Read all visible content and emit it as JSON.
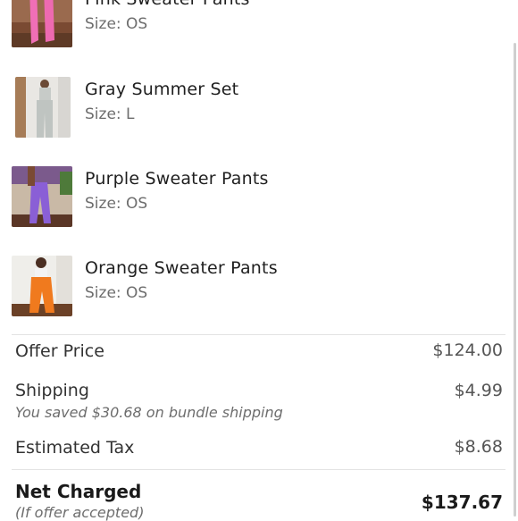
{
  "items": [
    {
      "name": "Pink Sweater Pants",
      "size": "Size: OS",
      "image": "pink-sweater-pants-photo"
    },
    {
      "name": "Gray Summer Set",
      "size": "Size: L",
      "image": "gray-summer-set-photo"
    },
    {
      "name": "Purple Sweater Pants",
      "size": "Size: OS",
      "image": "purple-sweater-pants-photo"
    },
    {
      "name": "Orange Sweater Pants",
      "size": "Size: OS",
      "image": "orange-sweater-pants-photo"
    }
  ],
  "summary": {
    "offer_price": {
      "label": "Offer Price",
      "value": "$124.00"
    },
    "shipping": {
      "label": "Shipping",
      "value": "$4.99",
      "note": "You saved $30.68 on bundle shipping"
    },
    "tax": {
      "label": "Estimated Tax",
      "value": "$8.68"
    },
    "net": {
      "label": "Net Charged",
      "value": "$137.67",
      "note": "(If offer accepted)"
    }
  },
  "colors": {
    "pink": "#f06fb6",
    "gray": "#bfc4c1",
    "purple": "#8a5fd6",
    "orange": "#f07a1e"
  }
}
